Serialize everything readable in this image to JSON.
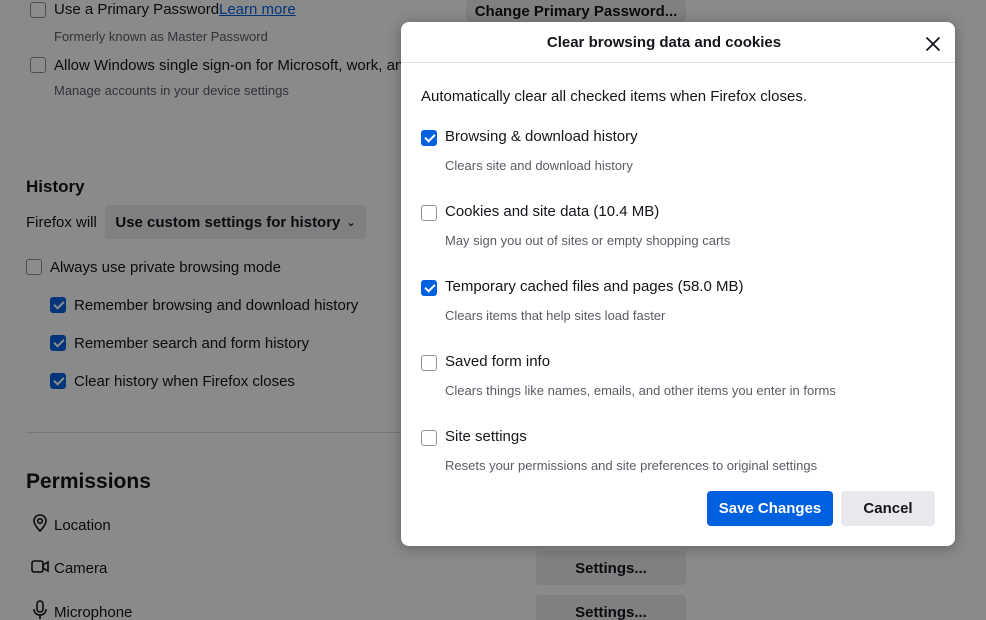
{
  "background": {
    "primary_password": {
      "label": "Use a Primary Password",
      "link": "Learn more",
      "sub": "Formerly known as Master Password",
      "checked": false
    },
    "change_primary_password_button": "Change Primary Password...",
    "windows_sso": {
      "label": "Allow Windows single sign-on for Microsoft, work, and",
      "sub": "Manage accounts in your device settings",
      "checked": false
    },
    "history": {
      "title": "History",
      "firefox_will_label": "Firefox will",
      "dropdown_value": "Use custom settings for history",
      "private_mode": {
        "label": "Always use private browsing mode",
        "checked": false
      },
      "items": [
        {
          "label": "Remember browsing and download history",
          "checked": true
        },
        {
          "label": "Remember search and form history",
          "checked": true
        },
        {
          "label": "Clear history when Firefox closes",
          "checked": true
        }
      ]
    },
    "permissions": {
      "title": "Permissions",
      "items": [
        {
          "label": "Location",
          "icon": "location-pin-icon"
        },
        {
          "label": "Camera",
          "icon": "camera-icon",
          "button": "Settings..."
        },
        {
          "label": "Microphone",
          "icon": "microphone-icon",
          "button": "Settings..."
        }
      ]
    }
  },
  "dialog": {
    "title": "Clear browsing data and cookies",
    "description": "Automatically clear all checked items when Firefox closes.",
    "options": [
      {
        "label": "Browsing & download history",
        "desc": "Clears site and download history",
        "checked": true
      },
      {
        "label": "Cookies and site data (10.4 MB)",
        "desc": "May sign you out of sites or empty shopping carts",
        "checked": false
      },
      {
        "label": "Temporary cached files and pages (58.0 MB)",
        "desc": "Clears items that help sites load faster",
        "checked": true
      },
      {
        "label": "Saved form info",
        "desc": "Clears things like names, emails, and other items you enter in forms",
        "checked": false
      },
      {
        "label": "Site settings",
        "desc": "Resets your permissions and site preferences to original settings",
        "checked": false
      }
    ],
    "save_button": "Save Changes",
    "cancel_button": "Cancel"
  },
  "colors": {
    "accent": "#0061e0",
    "overlay": "rgba(0,0,0,0.45)"
  }
}
